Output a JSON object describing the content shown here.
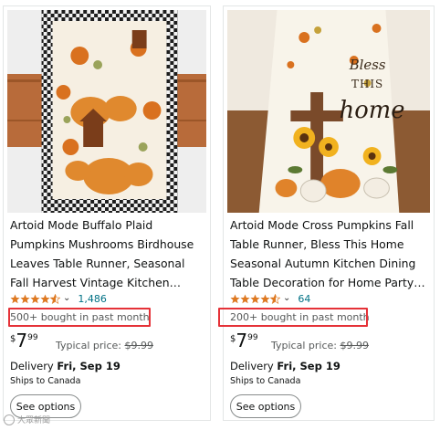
{
  "products": [
    {
      "title": "Artoid Mode Buffalo Plaid Pumpkins Mushrooms Birdhouse Leaves Table Runner, Seasonal Fall Harvest Vintage Kitchen Dining Table…",
      "rating_value": 4.5,
      "rating_count": "1,486",
      "bought": "500+ bought in past month",
      "price_symbol": "$",
      "price_whole": "7",
      "price_fraction": "99",
      "typical_label": "Typical price:",
      "typical_price": "$9.99",
      "delivery_label": "Delivery",
      "delivery_date": "Fri, Sep 19",
      "ships_to": "Ships to Canada",
      "button_label": "See options"
    },
    {
      "title": "Artoid Mode Cross Pumpkins Fall Table Runner, Bless This Home Seasonal Autumn Kitchen Dining Table Decoration for Home Party…",
      "rating_value": 4.5,
      "rating_count": "64",
      "bought": "200+ bought in past month",
      "price_symbol": "$",
      "price_whole": "7",
      "price_fraction": "99",
      "typical_label": "Typical price:",
      "typical_price": "$9.99",
      "delivery_label": "Delivery",
      "delivery_date": "Fri, Sep 19",
      "ships_to": "Ships to Canada",
      "button_label": "See options",
      "image_text_line1": "Bless",
      "image_text_line2": "THIS",
      "image_text_line3": "home"
    }
  ],
  "watermark": "大眾新聞",
  "colors": {
    "highlight": "#e53238",
    "link": "#007185",
    "star": "#de7921"
  }
}
